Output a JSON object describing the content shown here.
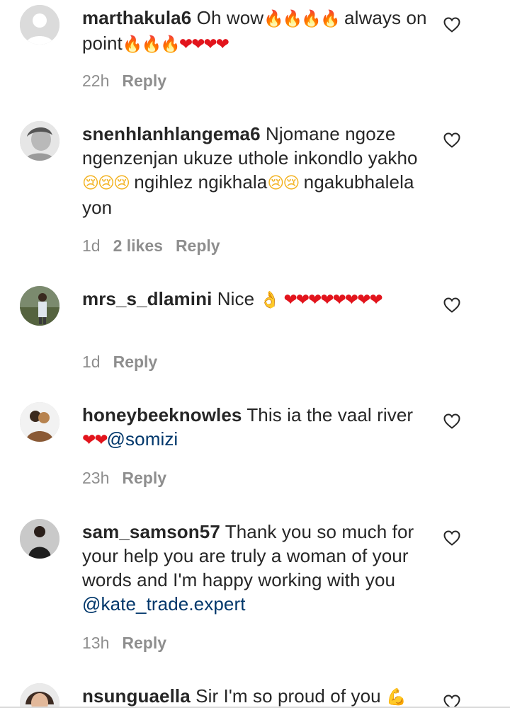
{
  "comments": [
    {
      "username": "marthakula6",
      "text": "Oh wow",
      "emoji_1": "🔥🔥🔥🔥",
      "text_2": "always on point",
      "emoji_2": "🔥🔥🔥",
      "emoji_3": "❤❤❤❤",
      "time": "22h",
      "likes": "",
      "reply": "Reply"
    },
    {
      "username": "snenhlanhlangema6",
      "text": "Njomane ngoze ngenzenjan ukuze uthole inkondlo yakho",
      "emoji_1": "😢😢😢",
      "text_2": "ngihlez ngikhala",
      "emoji_2": "😢😢",
      "text_3": "ngakubhalela yon",
      "time": "1d",
      "likes": "2 likes",
      "reply": "Reply"
    },
    {
      "username": "mrs_s_dlamini",
      "text": "Nice",
      "emoji_1": "👌",
      "emoji_2": "❤❤❤❤❤❤❤❤",
      "time": "1d",
      "likes": "",
      "reply": "Reply"
    },
    {
      "username": "honeybeeknowles",
      "text": "This ia the vaal river",
      "emoji_1": "❤❤",
      "mention": "@somizi",
      "time": "23h",
      "likes": "",
      "reply": "Reply"
    },
    {
      "username": "sam_samson57",
      "text": "Thank you so much for your help you are truly a woman of your words and I'm happy working with you",
      "mention": "@kate_trade.expert",
      "time": "13h",
      "likes": "",
      "reply": "Reply"
    },
    {
      "username": "nsunguaella",
      "text": "Sir I'm so proud of you",
      "emoji_1": "💪"
    }
  ],
  "icons": {
    "like": "heart-outline-icon",
    "avatar_placeholder": "user-silhouette-icon"
  },
  "colors": {
    "text": "#262626",
    "meta": "#8e8e8e",
    "mention": "#00376b"
  }
}
